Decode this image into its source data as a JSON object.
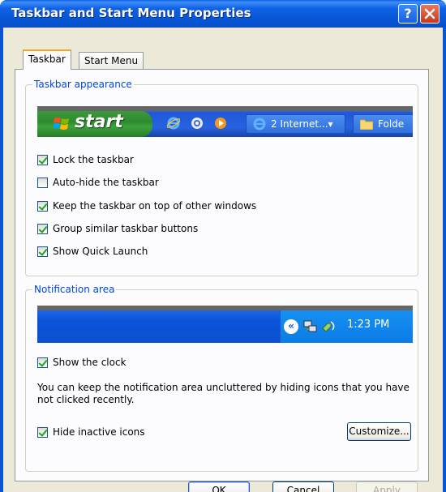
{
  "window": {
    "title": "Taskbar and Start Menu Properties",
    "help_icon": "help-icon",
    "close_icon": "close-icon"
  },
  "tabs": [
    {
      "label": "Taskbar",
      "active": true
    },
    {
      "label": "Start Menu",
      "active": false
    }
  ],
  "taskbar_appearance": {
    "label": "Taskbar appearance",
    "preview": {
      "start_label": "start",
      "quick_launch_icons": [
        "ie-icon",
        "outlook-icon",
        "media-player-icon"
      ],
      "task_buttons": [
        {
          "label": "2 Internet...▾",
          "icon": "ie-icon"
        },
        {
          "label": "Folde",
          "icon": "folder-icon"
        }
      ]
    },
    "options": [
      {
        "label": "Lock the taskbar",
        "checked": true
      },
      {
        "label": "Auto-hide the taskbar",
        "checked": false
      },
      {
        "label": "Keep the taskbar on top of other windows",
        "checked": true
      },
      {
        "label": "Group similar taskbar buttons",
        "checked": true
      },
      {
        "label": "Show Quick Launch",
        "checked": true
      }
    ]
  },
  "notification_area": {
    "label": "Notification area",
    "preview": {
      "time": "1:23 PM",
      "tray_icons": [
        "chevron-left-icon",
        "network-icon",
        "sound-icon"
      ]
    },
    "show_clock": {
      "label": "Show the clock",
      "checked": true
    },
    "description": "You can keep the notification area uncluttered by hiding icons that you have not clicked recently.",
    "hide_inactive": {
      "label": "Hide inactive icons",
      "checked": true
    },
    "customize_label": "Customize..."
  },
  "buttons": {
    "ok": "OK",
    "cancel": "Cancel",
    "apply": "Apply"
  },
  "colors": {
    "titlebar": "#0A53D6",
    "group_label": "#0046D5",
    "start_green": "#2F8A2F",
    "checkmark": "#21A121"
  }
}
